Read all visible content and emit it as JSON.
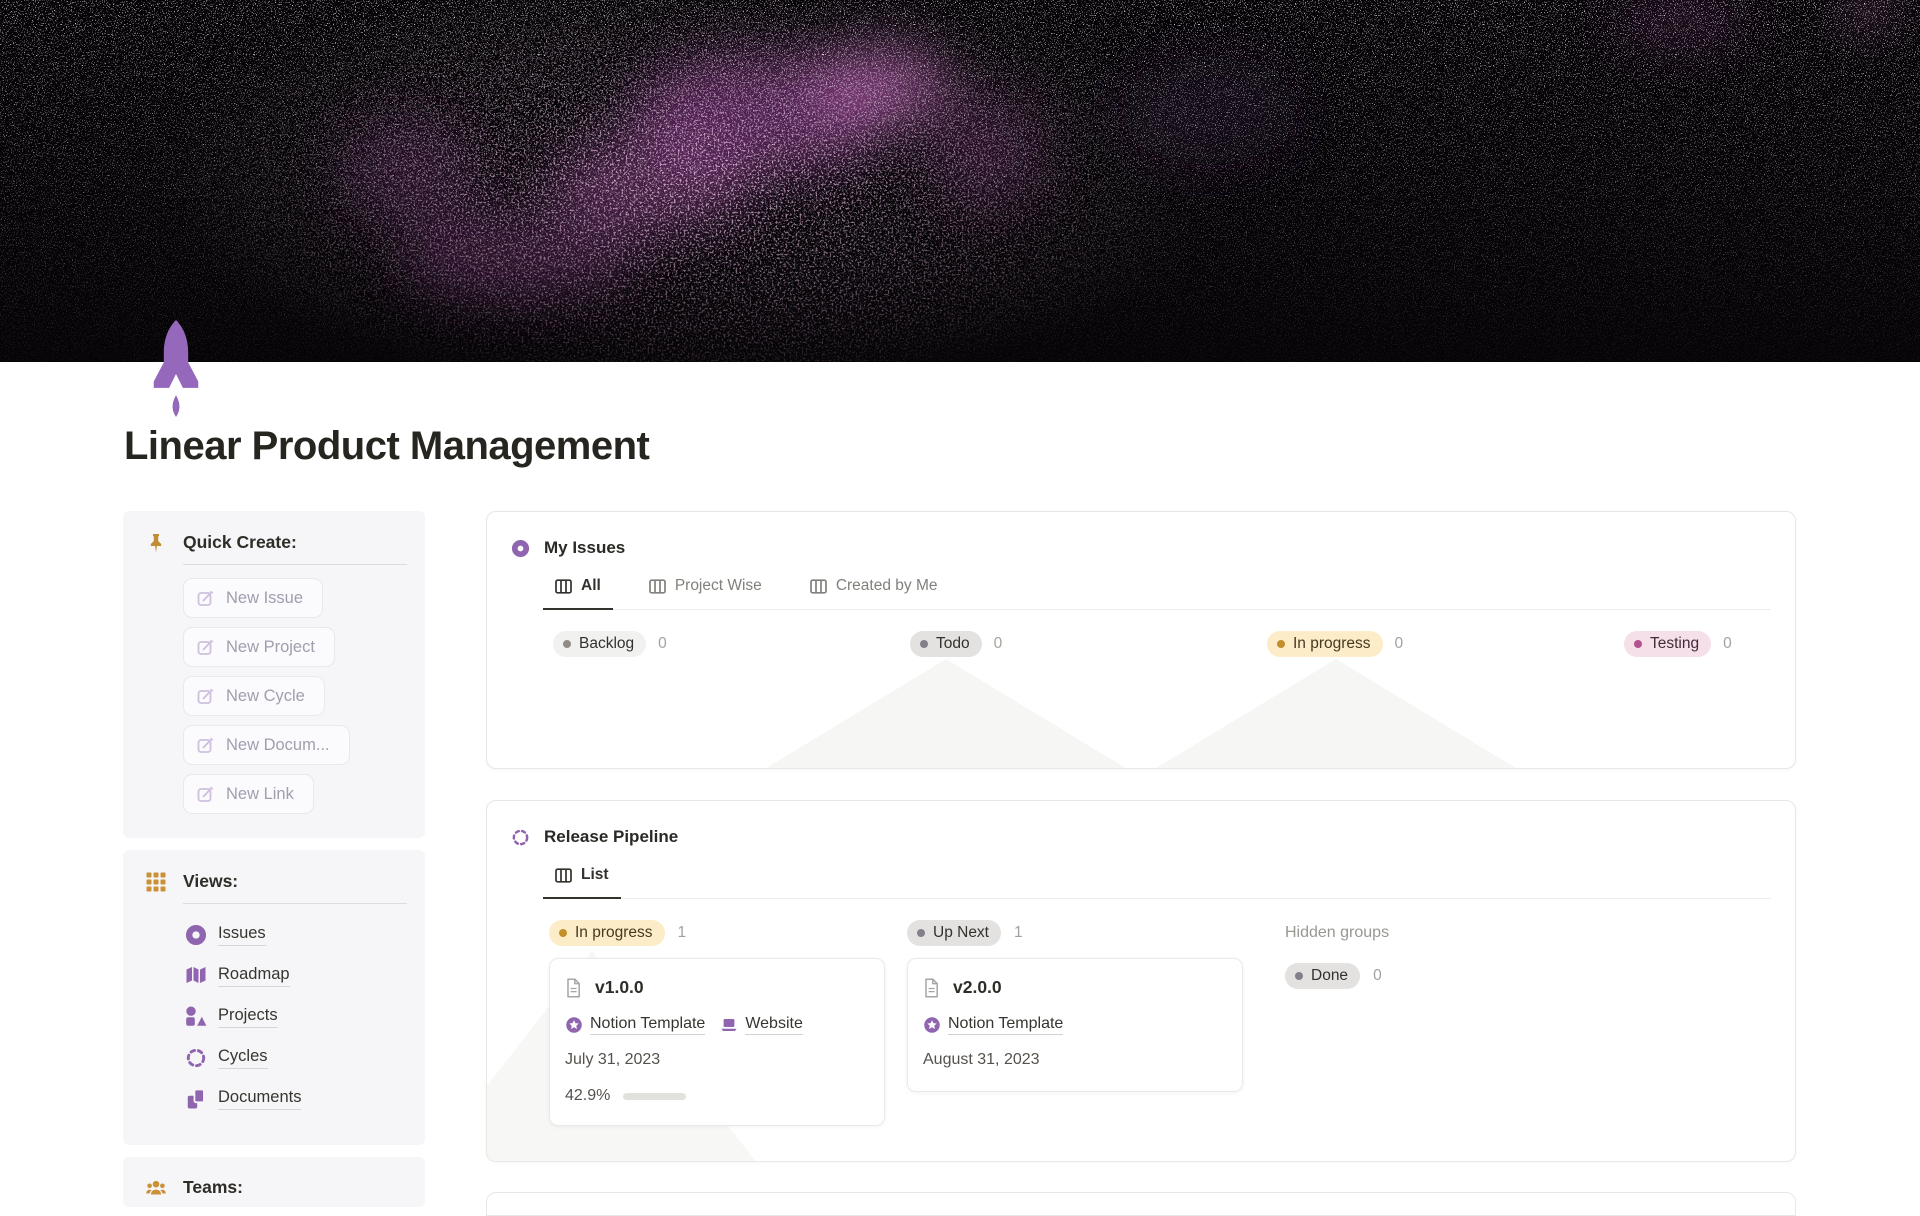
{
  "page": {
    "title": "Linear Product Management"
  },
  "cover": {
    "description": "black space nebula with pink-purple particle clouds and white stars",
    "background": "#060407",
    "nebula_pink": "#b058a8"
  },
  "rocket_color": "#9568bb",
  "colors": {
    "accent_purple": "#9065b0",
    "gold": "#c08f35",
    "badge_gray_bg": "#e3e2e0",
    "badge_lightgray_bg": "#f1f1ef",
    "badge_yellow_bg": "#fdecc8",
    "badge_pink_bg": "#f5e0e9",
    "yellow_dot": "#c28f2c",
    "pink_dot": "#b4518e",
    "gray_dot": "#83808c"
  },
  "sidebar": {
    "quick_create": {
      "title": "Quick Create:",
      "buttons": [
        {
          "label": "New Issue",
          "icon": "edit-pencil-icon"
        },
        {
          "label": "New Project",
          "icon": "edit-pencil-icon"
        },
        {
          "label": "New Cycle",
          "icon": "edit-pencil-icon"
        },
        {
          "label": "New Docum...",
          "icon": "edit-pencil-icon"
        },
        {
          "label": "New Link",
          "icon": "edit-pencil-icon"
        }
      ]
    },
    "views": {
      "title": "Views:",
      "items": [
        {
          "label": "Issues",
          "icon": "issue-donut-icon"
        },
        {
          "label": "Roadmap",
          "icon": "map-icon"
        },
        {
          "label": "Projects",
          "icon": "shapes-icon"
        },
        {
          "label": "Cycles",
          "icon": "dashed-circle-icon"
        },
        {
          "label": "Documents",
          "icon": "pages-icon"
        }
      ]
    },
    "teams": {
      "title": "Teams:"
    }
  },
  "my_issues": {
    "title": "My Issues",
    "tabs": [
      {
        "label": "All",
        "active": true
      },
      {
        "label": "Project Wise",
        "active": false
      },
      {
        "label": "Created by Me",
        "active": false
      }
    ],
    "columns": [
      {
        "label": "Backlog",
        "count": "0",
        "bg": "#f1f1ef",
        "dot": "#908d89"
      },
      {
        "label": "Todo",
        "count": "0",
        "bg": "#e3e2e0",
        "dot": "#83808c"
      },
      {
        "label": "In progress",
        "count": "0",
        "bg": "#fdecc8",
        "dot": "#c28f2c"
      },
      {
        "label": "Testing",
        "count": "0",
        "bg": "#f5e0e9",
        "dot": "#b4518e"
      }
    ]
  },
  "release_pipeline": {
    "title": "Release Pipeline",
    "tabs": [
      {
        "label": "List",
        "active": true
      }
    ],
    "columns": [
      {
        "badge": "In progress",
        "count": "1",
        "card": {
          "title": "v1.0.0",
          "links": [
            {
              "label": "Notion Template",
              "icon": "template-star-badge-icon"
            },
            {
              "label": "Website",
              "icon": "laptop-icon"
            }
          ],
          "date": "July 31, 2023",
          "progress_label": "42.9%",
          "progress_pct": 42.9
        }
      },
      {
        "badge": "Up Next",
        "count": "1",
        "card": {
          "title": "v2.0.0",
          "links": [
            {
              "label": "Notion Template",
              "icon": "template-star-badge-icon"
            }
          ],
          "date": "August 31, 2023"
        }
      },
      {
        "label": "Hidden groups",
        "badge": "Done",
        "count": "0"
      }
    ]
  }
}
